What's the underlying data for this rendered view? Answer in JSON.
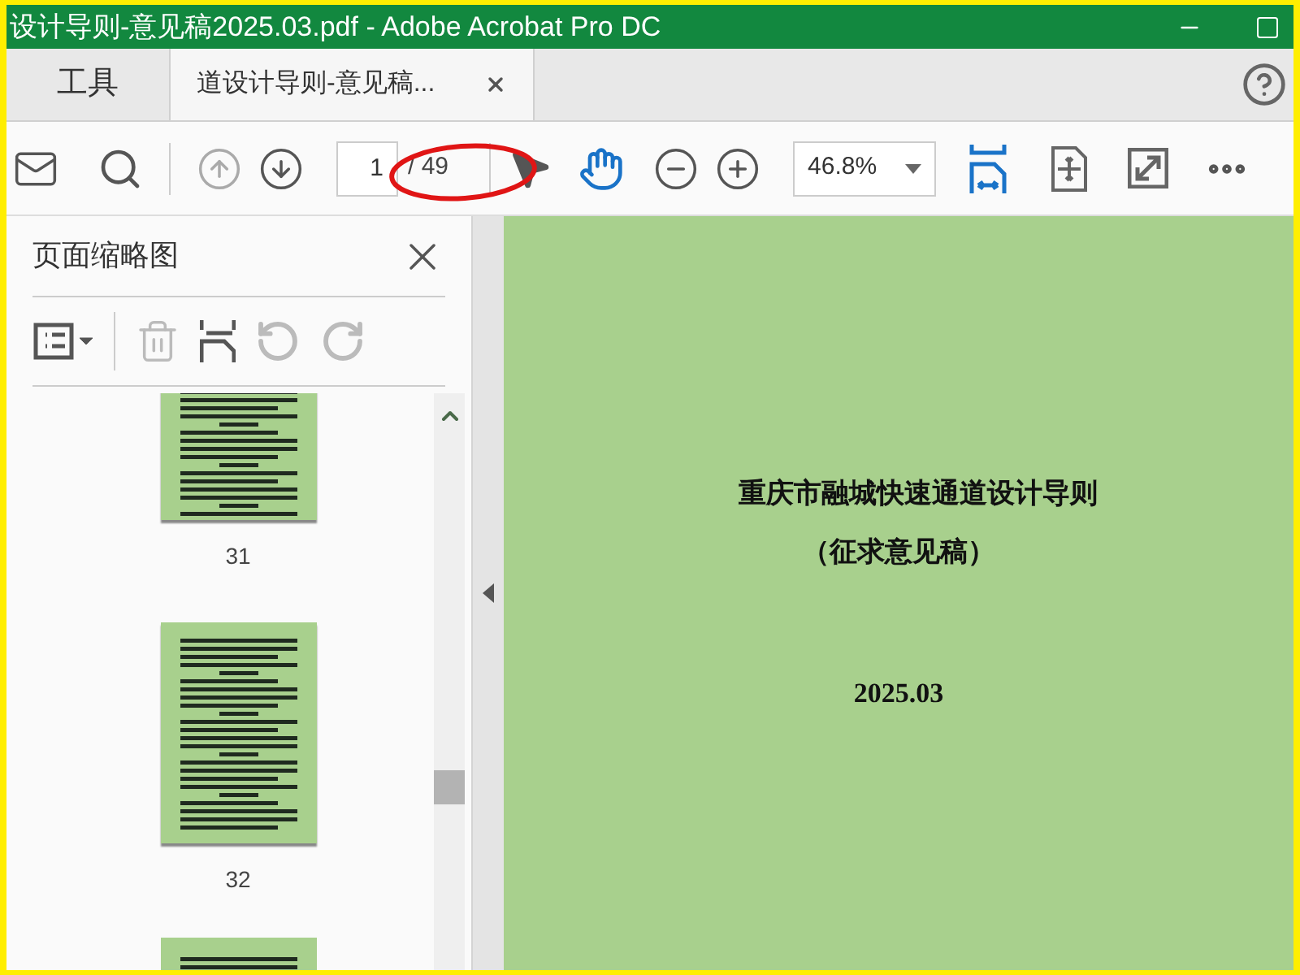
{
  "window": {
    "title": "设计导则-意见稿2025.03.pdf - Adobe Acrobat Pro DC"
  },
  "tabs": [
    {
      "label": "工具",
      "selected": false
    },
    {
      "label": "道设计导则-意见稿...",
      "selected": true
    }
  ],
  "toolbar": {
    "page_input": "1",
    "page_total": "/ 49",
    "zoom": "46.8%"
  },
  "sidebar": {
    "title": "页面缩略图",
    "thumbnails": [
      {
        "label": "31"
      },
      {
        "label": "32"
      }
    ]
  },
  "document": {
    "title": "重庆市融城快速通道设计导则",
    "subtitle": "（征求意见稿）",
    "date": "2025.03"
  }
}
